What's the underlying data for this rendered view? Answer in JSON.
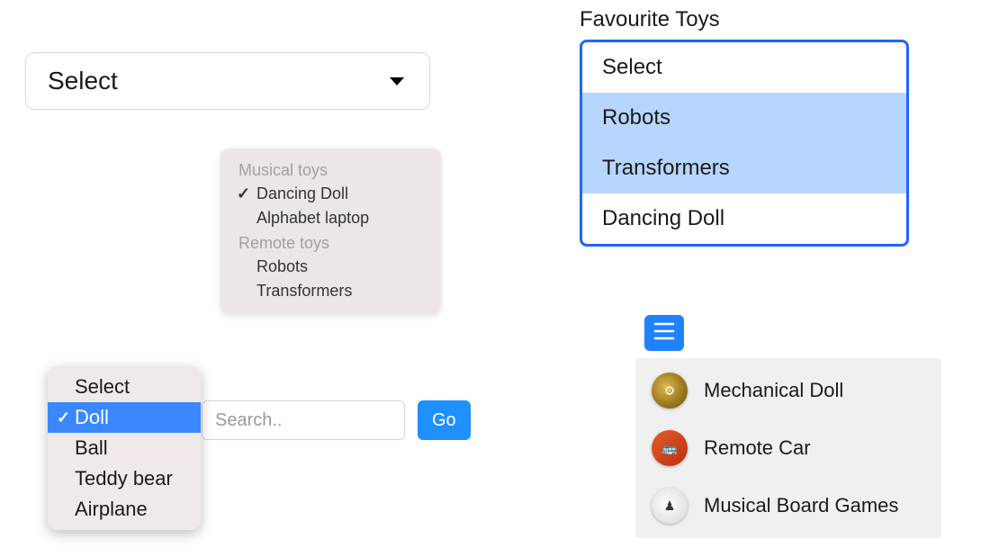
{
  "simpleSelect": {
    "value": "Select"
  },
  "groupedPopup": {
    "groups": [
      {
        "label": "Musical toys",
        "items": [
          {
            "label": "Dancing Doll",
            "checked": true
          },
          {
            "label": "Alphabet laptop",
            "checked": false
          }
        ]
      },
      {
        "label": "Remote toys",
        "items": [
          {
            "label": "Robots",
            "checked": false
          },
          {
            "label": "Transformers",
            "checked": false
          }
        ]
      }
    ]
  },
  "searchRow": {
    "placeholder": "Search..",
    "go": "Go"
  },
  "selPopup": {
    "items": [
      {
        "label": "Select",
        "selected": false
      },
      {
        "label": "Doll",
        "selected": true
      },
      {
        "label": "Ball",
        "selected": false
      },
      {
        "label": "Teddy bear",
        "selected": false
      },
      {
        "label": "Airplane",
        "selected": false
      }
    ]
  },
  "favourite": {
    "title": "Favourite Toys",
    "items": [
      {
        "label": "Select",
        "selected": false
      },
      {
        "label": "Robots",
        "selected": true
      },
      {
        "label": "Transformers",
        "selected": true
      },
      {
        "label": "Dancing Doll",
        "selected": false
      }
    ]
  },
  "imageList": {
    "items": [
      {
        "label": "Mechanical Doll",
        "thumbGlyph": "⚙",
        "thumbClass": "a"
      },
      {
        "label": "Remote Car",
        "thumbGlyph": "🚌",
        "thumbClass": "b"
      },
      {
        "label": "Musical Board Games",
        "thumbGlyph": "♟",
        "thumbClass": "c"
      }
    ]
  }
}
